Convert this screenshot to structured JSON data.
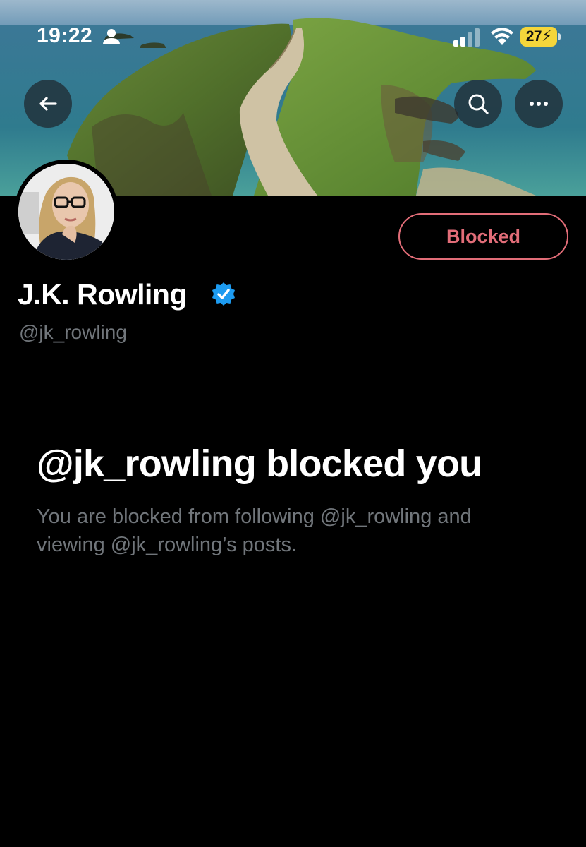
{
  "status_bar": {
    "time": "19:22",
    "battery_level": "27",
    "icons": [
      "person-icon",
      "signal-icon",
      "wifi-icon",
      "battery-charging-icon"
    ]
  },
  "nav": {
    "icons": [
      "back-arrow-icon",
      "search-icon",
      "more-options-icon"
    ]
  },
  "profile": {
    "display_name": "J.K. Rowling",
    "handle": "@jk_rowling",
    "verified": true,
    "relationship_button_label": "Blocked"
  },
  "blocked_notice": {
    "title": "@jk_rowling blocked you",
    "description": "You are blocked from following @jk_rowling and viewing @jk_rowling’s posts."
  },
  "colors": {
    "background": "#000000",
    "primary_text": "#ffffff",
    "secondary_text": "#71767b",
    "blocked_accent": "#e26d78",
    "verified_badge": "#1d9bf0",
    "battery": "#f5d63b"
  }
}
